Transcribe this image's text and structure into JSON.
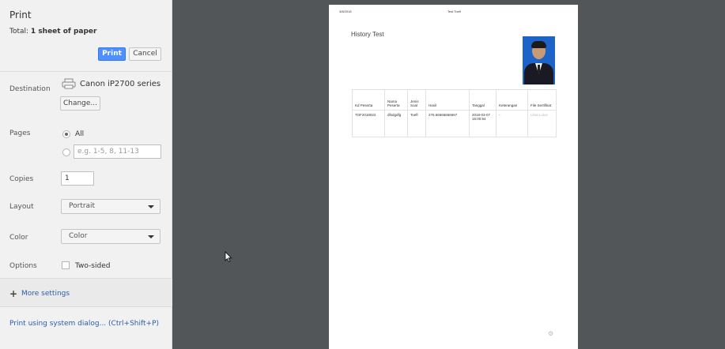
{
  "panel": {
    "title": "Print",
    "total_prefix": "Total: ",
    "total_value": "1 sheet of paper",
    "print_label": "Print",
    "cancel_label": "Cancel",
    "destination": {
      "label": "Destination",
      "printer": "Canon iP2700 series",
      "change_label": "Change..."
    },
    "pages": {
      "label": "Pages",
      "all_label": "All",
      "custom_placeholder": "e.g. 1-5, 8, 11-13"
    },
    "copies": {
      "label": "Copies",
      "value": "1"
    },
    "layout": {
      "label": "Layout",
      "value": "Portrait"
    },
    "color": {
      "label": "Color",
      "value": "Color"
    },
    "options": {
      "label": "Options",
      "two_sided_label": "Two-sided"
    },
    "more_settings": "More settings",
    "system_dialog": "Print using system dialog... (Ctrl+Shift+P)"
  },
  "page_preview": {
    "header_date": "3/8/2018",
    "header_title": "Test Toefl",
    "heading": "History Test",
    "table": {
      "headers": [
        "Kd Peserta",
        "Nama Peserta",
        "Jenis Soal",
        "Hasil",
        "Tanggal",
        "Keterangan",
        "File Sertifikat"
      ],
      "rows": [
        [
          "TOF2018022",
          "dfsdgdfg",
          "Toefl",
          "276.66666666667",
          "2018-03-07 15:00:54",
          "-",
          "Lihat Lulus"
        ]
      ]
    }
  }
}
